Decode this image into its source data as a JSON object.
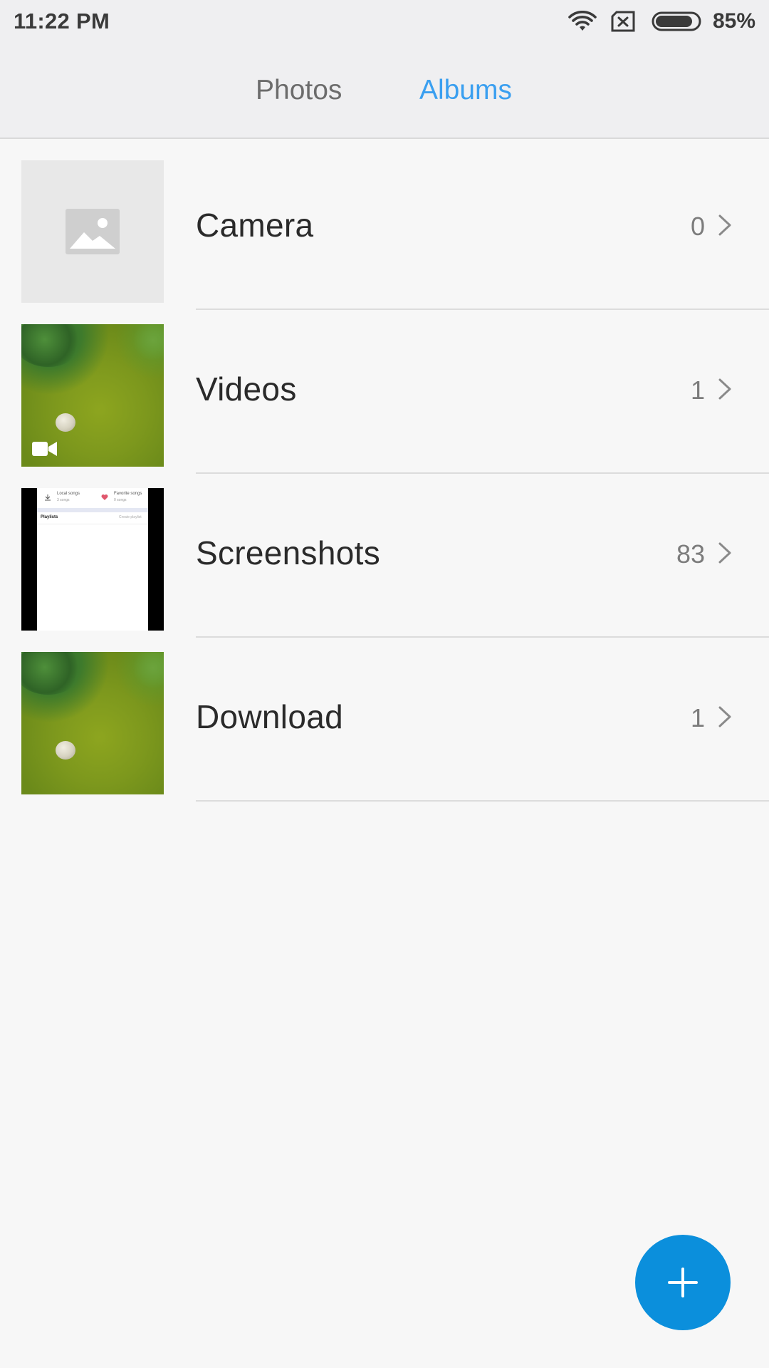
{
  "status_bar": {
    "time": "11:22 PM",
    "battery_percent": "85%",
    "battery_level": 0.85,
    "icons": [
      "wifi-icon",
      "sim-off-icon",
      "battery-icon"
    ]
  },
  "tabs": {
    "photos": "Photos",
    "albums": "Albums",
    "active": "Albums"
  },
  "albums": [
    {
      "name": "Camera",
      "count": "0",
      "thumbnail": "placeholder-image-icon"
    },
    {
      "name": "Videos",
      "count": "1",
      "thumbnail": "grass-video-thumbnail",
      "badge": "video-camera-icon"
    },
    {
      "name": "Screenshots",
      "count": "83",
      "thumbnail": "music-app-screenshot-thumbnail"
    },
    {
      "name": "Download",
      "count": "1",
      "thumbnail": "grass-photo-thumbnail"
    }
  ],
  "screenshot_thumb": {
    "item1": "Local songs",
    "item1_sub": "3 songs",
    "item2": "Favorite songs",
    "item2_sub": "0 songs",
    "section": "Playlists",
    "action": "Create playlist"
  },
  "fab": {
    "icon": "plus-icon"
  },
  "colors": {
    "accent": "#3a9ff0",
    "fab": "#0b8fdc",
    "header_bg": "#efeff1",
    "body_bg": "#f7f7f7"
  }
}
